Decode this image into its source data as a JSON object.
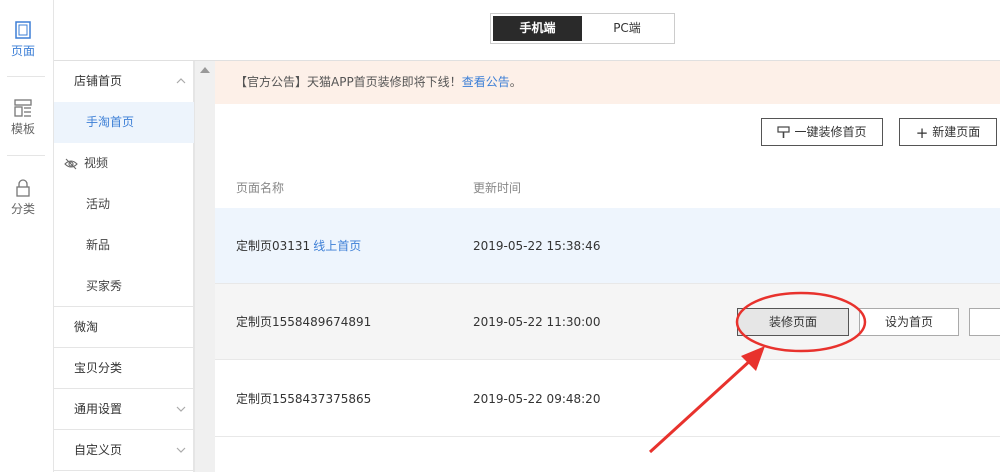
{
  "rail": {
    "items": [
      {
        "label": "页面",
        "icon": "page-icon"
      },
      {
        "label": "模板",
        "icon": "template-icon"
      },
      {
        "label": "分类",
        "icon": "lock-icon"
      }
    ]
  },
  "header": {
    "switch": {
      "mobile": "手机端",
      "pc": "PC端"
    }
  },
  "submenu": {
    "store_home": "店铺首页",
    "tao_home": "手淘首页",
    "video": "视频",
    "activity": "活动",
    "new": "新品",
    "buyer_show": "买家秀",
    "weitao": "微淘",
    "category": "宝贝分类",
    "settings": "通用设置",
    "custom": "自定义页"
  },
  "notice": {
    "text": "【官方公告】天猫APP首页装修即将下线！",
    "link": "查看公告",
    "tail": "。"
  },
  "toolbar": {
    "one_click": "一键装修首页",
    "new_page": "新建页面"
  },
  "table": {
    "headers": [
      "页面名称",
      "更新时间"
    ],
    "rows": [
      {
        "name": "定制页03131",
        "tag": "线上首页",
        "time": "2019-05-22 15:38:46"
      },
      {
        "name": "定制页1558489674891",
        "tag": "",
        "time": "2019-05-22 11:30:00",
        "actions": [
          "装修页面",
          "设为首页"
        ]
      },
      {
        "name": "定制页1558437375865",
        "tag": "",
        "time": "2019-05-22 09:48:20"
      }
    ]
  },
  "colors": {
    "accent": "#3d7fd6",
    "annotation": "#e8322d",
    "notice_bg": "#fdf0e8"
  }
}
